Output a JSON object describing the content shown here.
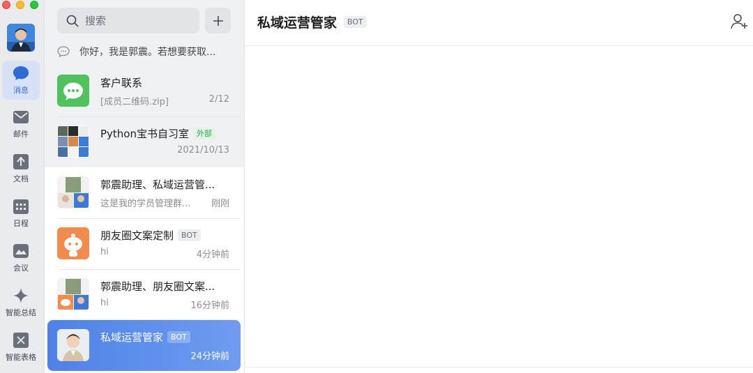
{
  "rail": {
    "nav": [
      {
        "label": "消息",
        "icon": "message-icon"
      },
      {
        "label": "邮件",
        "icon": "mail-icon"
      },
      {
        "label": "文档",
        "icon": "document-icon"
      },
      {
        "label": "日程",
        "icon": "calendar-icon"
      },
      {
        "label": "会议",
        "icon": "meeting-icon"
      },
      {
        "label": "智能总结",
        "icon": "sparkle-icon"
      },
      {
        "label": "智能表格",
        "icon": "smart-table-icon"
      }
    ]
  },
  "list": {
    "search_placeholder": "搜索",
    "notice": "你好，我是郭震。若想要获取...",
    "conversations": [
      {
        "name": "客户联系",
        "subtitle": "[成员二维码.zip]",
        "time": "2/12",
        "tag": ""
      },
      {
        "name": "Python宝书自习室",
        "subtitle": "",
        "time": "2021/10/13",
        "tag": "外部"
      },
      {
        "name": "郭震助理、私域运营管...",
        "subtitle": "这是我的学员管理群...",
        "time": "刚刚",
        "tag": ""
      },
      {
        "name": "朋友圈文案定制",
        "subtitle": "hi",
        "time": "4分钟前",
        "tag": "BOT"
      },
      {
        "name": "郭震助理、朋友圈文案...",
        "subtitle": "hi",
        "time": "16分钟前",
        "tag": ""
      },
      {
        "name": "私域运营管家",
        "subtitle": "",
        "time": "24分钟前",
        "tag": "BOT"
      }
    ]
  },
  "chat": {
    "title": "私域运营管家",
    "tag": "BOT"
  },
  "colors": {
    "accent": "#4d82e8",
    "rail_bg": "#e9ebef",
    "list_bg": "#f0f1f3",
    "external_tag": "#2ea44f"
  }
}
